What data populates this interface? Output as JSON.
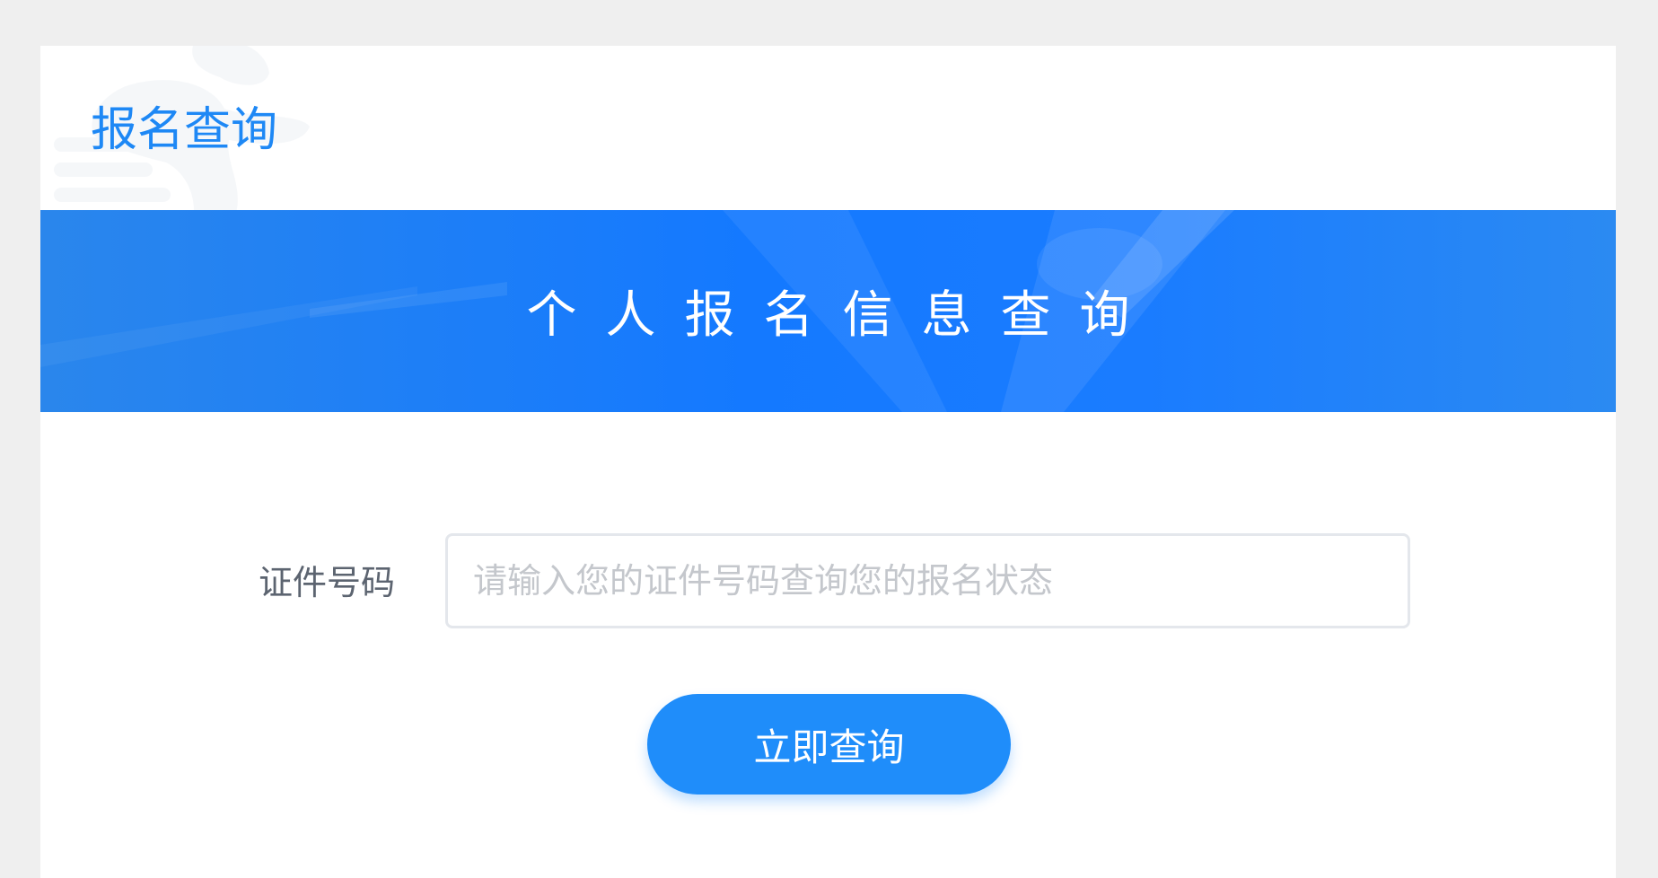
{
  "header": {
    "title": "报名查询"
  },
  "banner": {
    "title": "个人报名信息查询"
  },
  "form": {
    "id_label": "证件号码",
    "id_placeholder": "请输入您的证件号码查询您的报名状态",
    "id_value": "",
    "submit_label": "立即查询"
  },
  "colors": {
    "accent": "#1e88f5",
    "banner": "#1479ff",
    "button": "#1f8dfa",
    "background": "#efefef"
  },
  "icons": {
    "header_decoration": "runner-icon"
  }
}
